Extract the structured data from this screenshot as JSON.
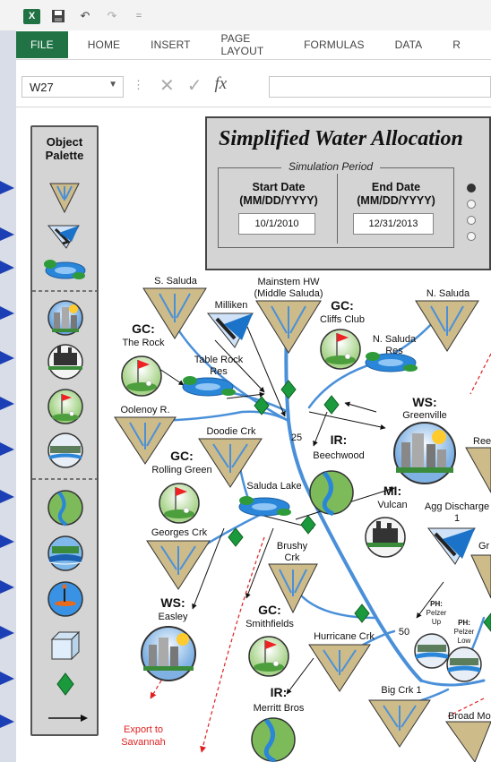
{
  "toolbar": {
    "excel_logo": "X",
    "undo_glyph": "↶",
    "redo_glyph": "↷",
    "customize_glyph": "="
  },
  "ribbon": {
    "tabs": [
      "FILE",
      "HOME",
      "INSERT",
      "PAGE LAYOUT",
      "FORMULAS",
      "DATA",
      "R"
    ]
  },
  "formula_bar": {
    "name_box": "W27",
    "fx": "fx",
    "formula": ""
  },
  "palette": {
    "title_line1": "Object",
    "title_line2": "Palette",
    "icons": [
      "inflow-node-icon",
      "reservoir-inflow-icon",
      "reservoir-icon",
      "water-supply-icon",
      "industrial-icon",
      "golf-course-icon",
      "power-plant-icon",
      "irrigation-icon",
      "hydro-icon",
      "recreation-icon",
      "discharge-box-icon",
      "junction-icon",
      "link-arrow-icon"
    ]
  },
  "simulation": {
    "title": "Simplified Water Allocation",
    "period_label": "Simulation Period",
    "start_label_1": "Start Date",
    "start_label_2": "(MM/DD/YYYY)",
    "end_label_1": "End Date",
    "end_label_2": "(MM/DD/YYYY)",
    "start_value": "10/1/2010",
    "end_value": "12/31/2013"
  },
  "network": {
    "s_saluda": "S. Saluda",
    "mainstem_1": "Mainstem HW",
    "mainstem_2": "(Middle Saluda)",
    "milliken": "Milliken",
    "gc_cliffs_1": "GC:",
    "gc_cliffs_2": "Cliffs Club",
    "n_saluda": "N. Saluda",
    "n_saluda_res_1": "N. Saluda",
    "n_saluda_res_2": "Res",
    "gc_rock_1": "GC:",
    "gc_rock_2": "The Rock",
    "table_rock_1": "Table Rock",
    "table_rock_2": "Res",
    "ws_greenville_1": "WS:",
    "ws_greenville_2": "Greenville",
    "oolenoy": "Oolenoy R.",
    "doodie": "Doodie Crk",
    "num_25": "25",
    "ir_beechwood_1": "IR:",
    "ir_beechwood_2": "Beechwood",
    "ree": "Ree",
    "gc_rolling_1": "GC:",
    "gc_rolling_2": "Rolling Green",
    "saluda_lake": "Saluda Lake",
    "mi_vulcan_1": "MI:",
    "mi_vulcan_2": "Vulcan",
    "agg_discharge_1": "Agg Discharge",
    "agg_discharge_2": "1",
    "georges": "Georges Crk",
    "brushy_1": "Brushy",
    "brushy_2": "Crk",
    "gr": "Gr",
    "ws_easley_1": "WS:",
    "ws_easley_2": "Easley",
    "gc_smith_1": "GC:",
    "gc_smith_2": "Smithfields",
    "hurricane": "Hurricane Crk",
    "num_50": "50",
    "ph_pelzer_up_1": "PH:",
    "ph_pelzer_up_2": "Pelzer",
    "ph_pelzer_up_3": "Up",
    "ph_pelzer_low_1": "PH:",
    "ph_pelzer_low_2": "Pelzer",
    "ph_pelzer_low_3": "Low",
    "ir_merritt_1": "IR:",
    "ir_merritt_2": "Merritt Bros",
    "big_crk": "Big Crk 1",
    "broad_mo": "Broad Mo",
    "export_1": "Export to",
    "export_2": "Savannah"
  },
  "colors": {
    "river": "#4a90d9",
    "junction": "#1a9a3c",
    "triangle": "#cdbb8a",
    "export": "#e02020"
  }
}
